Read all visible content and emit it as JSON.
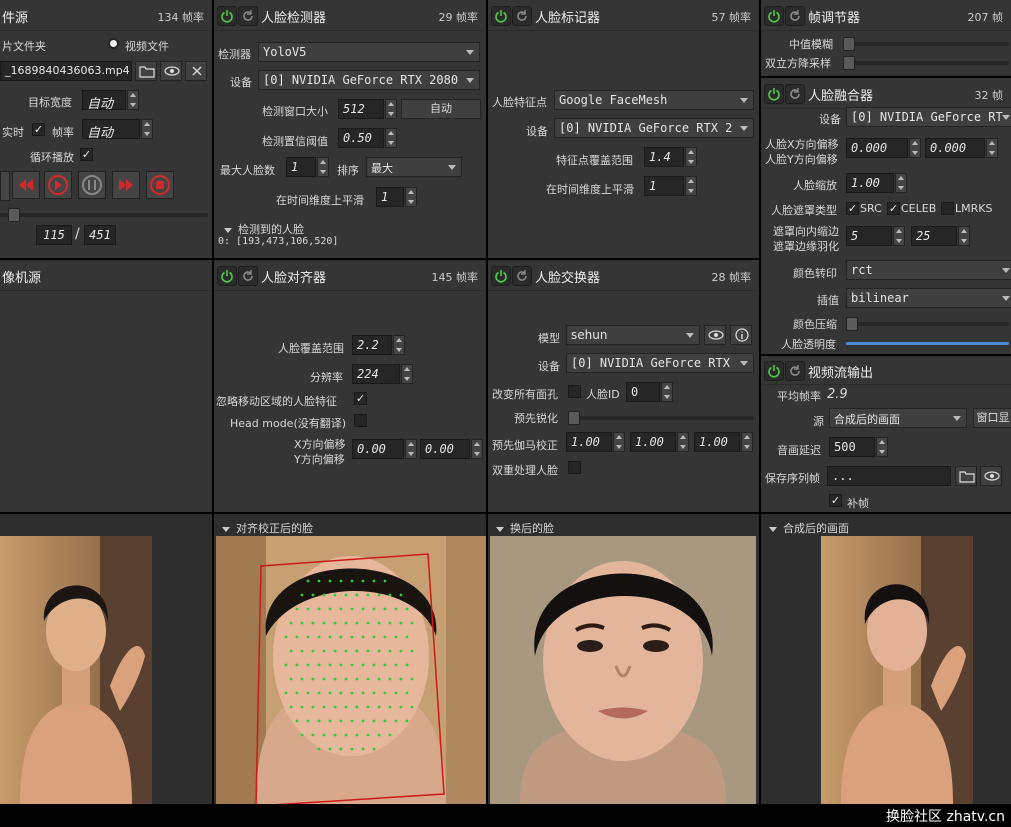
{
  "file_source": {
    "title": "件源",
    "fps": "134 帧率",
    "image_folder": "片文件夹",
    "video_file": "视频文件",
    "file_path": "_1689840436063.mp4",
    "target_width_label": "目标宽度",
    "target_width_value": "自动",
    "realtime_label": "实时",
    "realtime_check": "✓",
    "fps_label": "帧率",
    "fps_value": "自动",
    "loop_label": "循环播放",
    "loop_check": "✓",
    "frame_current": "115",
    "frame_total": "451"
  },
  "camera_source": {
    "title": "像机源"
  },
  "face_detector": {
    "title": "人脸检测器",
    "fps": "29 帧率",
    "detector_label": "检测器",
    "detector_value": "YoloV5",
    "device_label": "设备",
    "device_value": "[0] NVIDIA GeForce RTX 2080",
    "window_label": "检测窗口大小",
    "window_value": "512",
    "auto_button": "自动",
    "threshold_label": "检测置信阈值",
    "threshold_value": "0.50",
    "max_faces_label": "最大人脸数",
    "max_faces_value": "1",
    "sort_label": "排序",
    "sort_value": "最大",
    "temporal_label": "在时间维度上平滑",
    "temporal_value": "1",
    "detected_header": "检测到的人脸",
    "detected_value": "0: [193,473,106,520]"
  },
  "face_marker": {
    "title": "人脸标记器",
    "fps": "57 帧率",
    "marker_label": "人脸特征点",
    "marker_value": "Google FaceMesh",
    "device_label": "设备",
    "device_value": "[0] NVIDIA GeForce RTX 2",
    "coverage_label": "特征点覆盖范围",
    "coverage_value": "1.4",
    "temporal_label": "在时间维度上平滑",
    "temporal_value": "1"
  },
  "frame_adjuster": {
    "title": "帧调节器",
    "fps": "207 帧",
    "median_label": "中值模糊",
    "bilateral_label": "双立方降采样"
  },
  "face_merger": {
    "title": "人脸融合器",
    "fps": "32 帧",
    "device_label": "设备",
    "device_value": "[0] NVIDIA GeForce RT",
    "x_offset_label": "人脸X方向偏移",
    "y_offset_label": "人脸Y方向偏移",
    "x_offset_value": "0.000",
    "y_offset_value": "0.000",
    "scale_label": "人脸缩放",
    "scale_value": "1.00",
    "mask_type_label": "人脸遮罩类型",
    "mask_src": "SRC",
    "mask_celeb": "CELEB",
    "mask_lmrks": "LMRKS",
    "mask_erode_label": "遮罩向内缩边",
    "mask_blur_label": "遮罩边缘羽化",
    "mask_erode_value": "5",
    "mask_blur_value": "25",
    "color_transfer_label": "颜色转印",
    "color_transfer_value": "rct",
    "interp_label": "插值",
    "interp_value": "bilinear",
    "color_compress_label": "颜色压缩",
    "opacity_label": "人脸透明度"
  },
  "face_aligner": {
    "title": "人脸对齐器",
    "fps": "145 帧率",
    "coverage_label": "人脸覆盖范围",
    "coverage_value": "2.2",
    "resolution_label": "分辨率",
    "resolution_value": "224",
    "exclude_moving_label": "忽略移动区域的人脸特征",
    "exclude_moving_check": "✓",
    "head_mode_label": "Head mode(没有翻译)",
    "x_offset_label": "X方向偏移",
    "y_offset_label": "Y方向偏移",
    "x_offset_value": "0.00",
    "y_offset_value": "0.00",
    "aligned_header": "对齐校正后的脸"
  },
  "face_swapper": {
    "title": "人脸交换器",
    "fps": "28 帧率",
    "model_label": "模型",
    "model_value": "sehun",
    "device_label": "设备",
    "device_value": "[0] NVIDIA GeForce RTX",
    "swap_all_label": "改变所有面孔",
    "face_id_label": "人脸ID",
    "face_id_value": "0",
    "presharpen_label": "预先锐化",
    "pregamma_label": "预先伽马校正",
    "gamma_r": "1.00",
    "gamma_g": "1.00",
    "gamma_b": "1.00",
    "two_pass_label": "双重处理人脸",
    "swapped_header": "换后的脸"
  },
  "stream_output": {
    "title": "视频流输出",
    "avg_fps_label": "平均帧率",
    "avg_fps_value": "2.9",
    "source_label": "源",
    "source_value": "合成后的画面",
    "window_button": "窗口显",
    "delay_label": "音画延迟",
    "delay_value": "500",
    "save_seq_label": "保存序列帧",
    "save_seq_value": "...",
    "fill_label": "补帧",
    "fill_check": "✓",
    "merged_header": "合成后的画面"
  },
  "watermark": "换脸社区 zhatv.cn",
  "colors": {
    "panel": "#353535",
    "field": "#262626",
    "power_green": "#52c84a",
    "play_red": "#d02a2a",
    "accent_blue": "#4a90d9"
  }
}
